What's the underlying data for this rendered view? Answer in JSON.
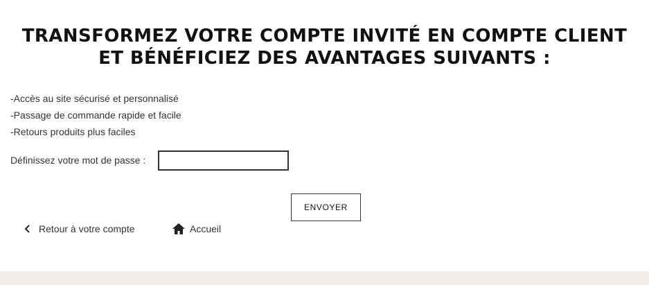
{
  "page": {
    "title": "TRANSFORMEZ VOTRE COMPTE INVITÉ EN COMPTE CLIENT ET BÉNÉFICIEZ DES AVANTAGES SUIVANTS :"
  },
  "benefits": [
    "-Accès au site sécurisé et personnalisé",
    "-Passage de commande rapide et facile",
    "-Retours produits plus faciles"
  ],
  "form": {
    "password_label": "Définissez votre mot de passe :",
    "password_value": "",
    "submit_label": "ENVOYER"
  },
  "nav": {
    "back_label": "Retour à votre compte",
    "back_icon": "chevron-left-icon",
    "home_label": "Accueil",
    "home_icon": "home-icon"
  },
  "colors": {
    "text": "#222222",
    "border": "#333333",
    "footer_background": "#f1eeeb"
  }
}
